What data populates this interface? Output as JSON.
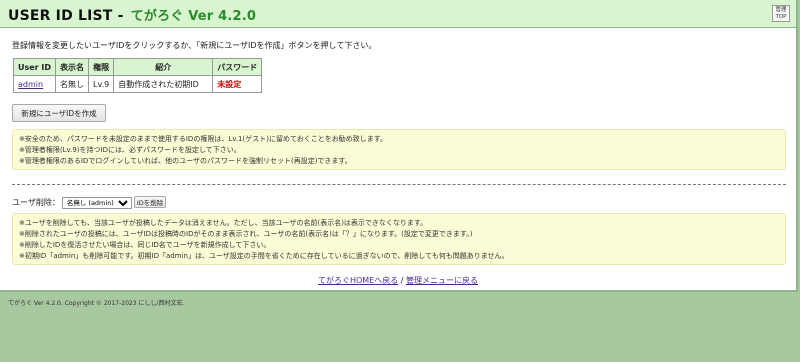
{
  "header": {
    "title": "USER ID LIST - ",
    "app_name": "てがろぐ Ver 4.2.0",
    "top_link_line1": "管理",
    "top_link_line2": "TOP"
  },
  "instruction": "登録情報を変更したいユーザIDをクリックするか、「新規にユーザIDを作成」ボタンを押して下さい。",
  "users_table": {
    "headers": [
      "User ID",
      "表示名",
      "権限",
      "紹介",
      "パスワード"
    ],
    "rows": [
      {
        "user_id": "admin",
        "display_name": "名無し",
        "level": "Lv.9",
        "intro": "自動作成された初期ID",
        "password": "未設定"
      }
    ]
  },
  "new_user_button": "新規にユーザIDを作成",
  "notes1": [
    "※安全のため、パスワードを未設定のままで使用するIDの権限は、Lv.1(ゲスト)に留めておくことをお勧め致します。",
    "※管理者権限(Lv.9)を持つIDには、必ずパスワードを設定して下さい。",
    "※管理者権限のあるIDでログインしていれば、他のユーザのパスワードを強制リセット(再設定)できます。"
  ],
  "delete": {
    "label": "ユーザ削除：",
    "selected_option": "名無し (admin)",
    "button": "IDを削除"
  },
  "notes2": [
    "※ユーザを削除しても、当該ユーザが投稿したデータは消えません。ただし、当該ユーザの名前(表示名)は表示できなくなります。",
    "※削除されたユーザの投稿には、ユーザIDは投稿時のIDがそのまま表示され、ユーザの名前(表示名)は「？」になります。(設定で変更できます。)",
    "※削除したIDを復活させたい場合は、同じID名でユーザを新規作成して下さい。",
    "※初期ID「admin」も削除可能です。初期ID「admin」は、ユーザ設定の手間を省くために存在しているに過ぎないので、削除しても何も問題ありません。"
  ],
  "footer_links": {
    "home": "てがろぐHOMEへ戻る",
    "separator": " / ",
    "admin_menu": "管理メニューに戻る"
  },
  "copyright": "てがろぐ Ver 4.2.0, Copyright © 2017-2023 にしし/西村文宏."
}
